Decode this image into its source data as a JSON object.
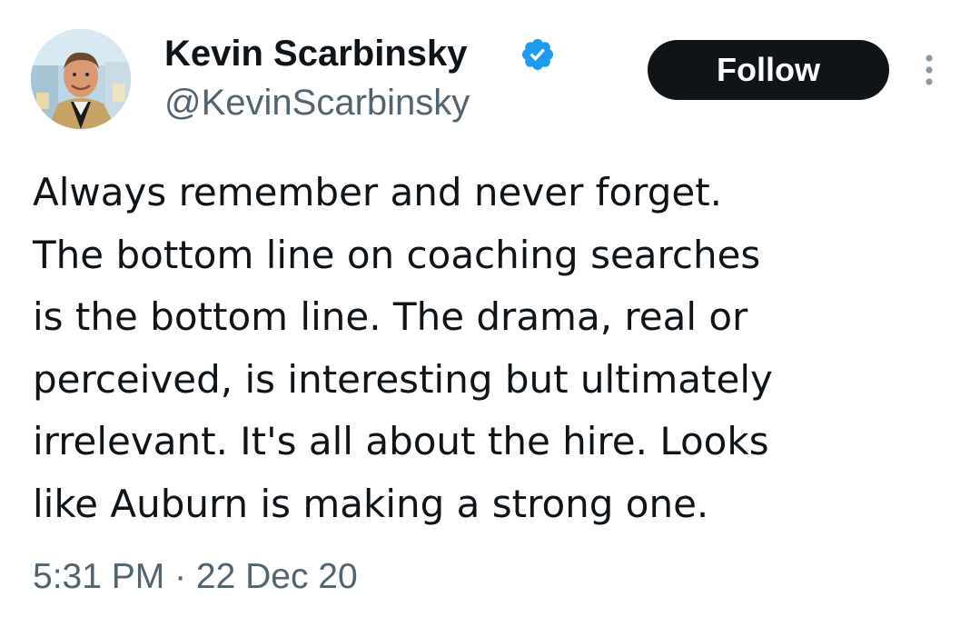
{
  "tweet": {
    "author": {
      "display_name": "Kevin Scarbinsky",
      "handle": "@KevinScarbinsky",
      "verified": true,
      "verified_icon": "verified-badge-icon",
      "verified_color": "#1d9bf0"
    },
    "follow_label": "Follow",
    "more_icon": "more-options-icon",
    "text_lines": [
      "Always remember and never forget.",
      "The bottom line on coaching searches",
      "is the bottom line. The drama, real or",
      "perceived, is interesting but ultimately",
      "irrelevant. It's all about the hire. Looks",
      "like Auburn is making a strong one."
    ],
    "timestamp": "5:31 PM · 22 Dec 20"
  },
  "colors": {
    "text_primary": "#0f1419",
    "text_secondary": "#536471",
    "follow_button_bg": "#0f1419",
    "follow_button_text": "#ffffff",
    "background": "#ffffff"
  }
}
